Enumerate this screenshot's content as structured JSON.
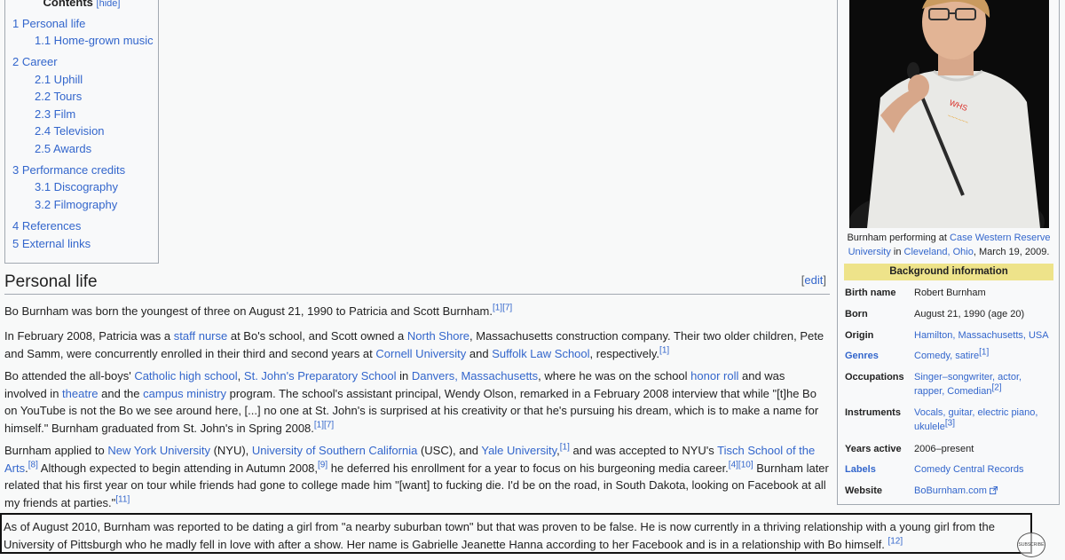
{
  "toc": {
    "title": "Contents",
    "hide": "[hide]",
    "items": [
      {
        "label": "1 Personal life"
      },
      {
        "label": "1.1 Home-grown music"
      },
      {
        "label": "2 Career"
      },
      {
        "label": "2.1 Uphill"
      },
      {
        "label": "2.2 Tours"
      },
      {
        "label": "2.3 Film"
      },
      {
        "label": "2.4 Television"
      },
      {
        "label": "2.5 Awards"
      },
      {
        "label": "3 Performance credits"
      },
      {
        "label": "3.1 Discography"
      },
      {
        "label": "3.2 Filmography"
      },
      {
        "label": "4 References"
      },
      {
        "label": "5 External links"
      }
    ]
  },
  "section": {
    "title": "Personal life",
    "edit": "[edit]"
  },
  "paragraphs": {
    "p1": {
      "t1": "Bo Burnham was born the youngest of three on August 21, 1990 to Patricia and Scott Burnham.",
      "r1": "[1][7]"
    },
    "p2": {
      "t1": "In February 2008, Patricia was a ",
      "l1": "staff nurse",
      "t2": " at Bo's school, and Scott owned a ",
      "l2": "North Shore",
      "t3": ", Massachusetts construction company. Their two older children, Pete and Samm, were concurrently enrolled in their third and second years at ",
      "l3": "Cornell University",
      "t4": " and ",
      "l4": "Suffolk Law School",
      "t5": ", respectively.",
      "r1": "[1]"
    },
    "p3": {
      "t1": "Bo attended the all-boys' ",
      "l1": "Catholic high school",
      "t2": ", ",
      "l2": "St. John's Preparatory School",
      "t3": " in ",
      "l3": "Danvers, Massachusetts",
      "t4": ", where he was on the school ",
      "l4": "honor roll",
      "t5": " and was involved in ",
      "l5": "theatre",
      "t6": " and the ",
      "l6": "campus ministry",
      "t7": " program. The school's assistant principal, Wendy Olson, remarked in a February 2008 interview that while \"[t]he Bo on YouTube is not the Bo we see around here, [...] no one at St. John's is surprised at his creativity or that he's pursuing his dream, which is to make a name for himself.\" Burnham graduated from St. John's in Spring 2008.",
      "r1": "[1][7]"
    },
    "p4": {
      "t1": "Burnham applied to ",
      "l1": "New York University",
      "t2": " (NYU), ",
      "l2": "University of Southern California",
      "t3": " (USC), and ",
      "l3": "Yale University",
      "t4": ",",
      "r1": "[1]",
      "t5": " and was accepted to NYU's ",
      "l4": "Tisch School of the Arts",
      "t6": ".",
      "r2": "[8]",
      "t7": " Although expected to begin attending in Autumn 2008,",
      "r3": "[9]",
      "t8": " he deferred his enrollment for a year to focus on his burgeoning media career.",
      "r4": "[4][10]",
      "t9": " Burnham later related that his first year on tour while friends had gone to college made him \"[want] to fucking die. I'd be on the road, in South Dakota, looking on Facebook at all my friends at parties.\"",
      "r5": "[11]"
    },
    "p5": {
      "t1": "As of August 2010, Burnham was reported to be dating a girl from \"a nearby suburban town\" but that was proven to be false. He is now currently in a thriving relationship with a young girl from the University of Pittsburgh who he madly fell in love with after a show. Her name is Gabrielle Jeanette Hanna according to her Facebook and is in a relationship with Bo himself.",
      "r1": "[12]"
    }
  },
  "infobox": {
    "caption": {
      "t1": "Burnham performing at ",
      "l1": "Case Western Reserve University",
      "t2": " in ",
      "l2": "Cleveland, Ohio",
      "t3": ", March 19, 2009."
    },
    "bg_header": "Background information",
    "rows": {
      "birth_name": {
        "label": "Birth name",
        "value": "Robert Burnham"
      },
      "born": {
        "label": "Born",
        "value": "August 21, 1990 (age 20)"
      },
      "origin": {
        "label": "Origin",
        "value": "Hamilton, Massachusetts, USA"
      },
      "genres": {
        "label": "Genres",
        "value": "Comedy, satire",
        "ref": "[1]"
      },
      "occupations": {
        "label": "Occupations",
        "value": "Singer–songwriter, actor, rapper, Comedian",
        "ref": "[2]"
      },
      "instruments": {
        "label": "Instruments",
        "value": "Vocals, guitar, electric piano, ukulele",
        "ref": "[3]"
      },
      "years_active": {
        "label": "Years active",
        "value": "2006–present"
      },
      "labels": {
        "label": "Labels",
        "value": "Comedy Central Records"
      },
      "website": {
        "label": "Website",
        "value": "BoBurnham.com"
      }
    }
  },
  "overlay": {
    "subscribe": "SUBSCRIBE"
  }
}
